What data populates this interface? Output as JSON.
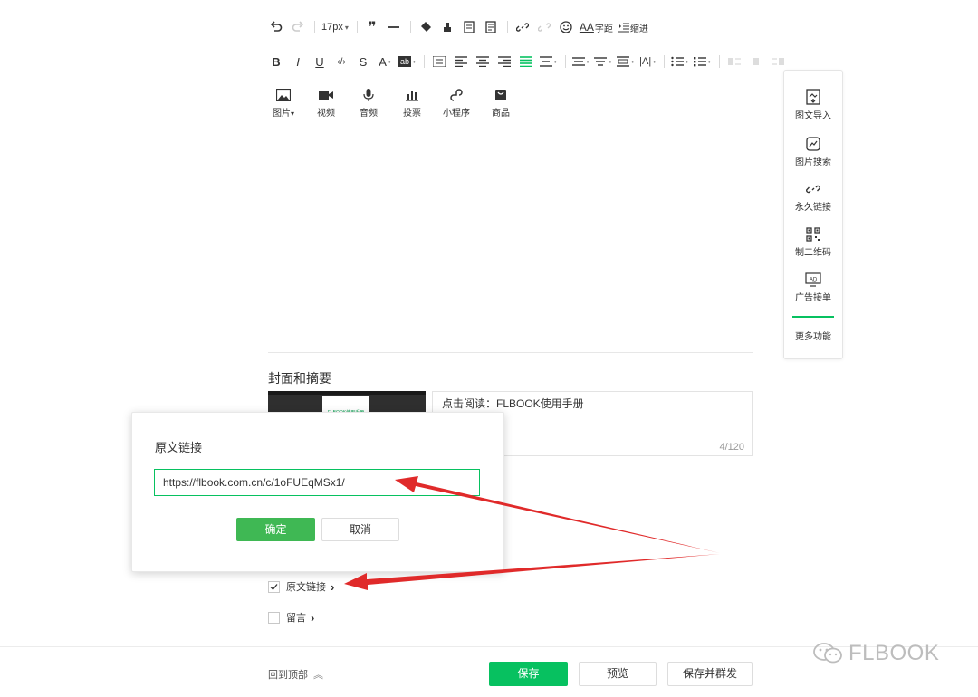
{
  "toolbar": {
    "font_size": "17px",
    "letter_spacing_label": "字距",
    "indent_label": "缩进",
    "text_color_label": "A",
    "highlight_label": "ab"
  },
  "insert_bar": [
    {
      "label": "图片",
      "icon": "image-icon"
    },
    {
      "label": "视频",
      "icon": "video-icon"
    },
    {
      "label": "音频",
      "icon": "audio-icon"
    },
    {
      "label": "投票",
      "icon": "vote-icon"
    },
    {
      "label": "小程序",
      "icon": "mini-program-icon"
    },
    {
      "label": "商品",
      "icon": "product-icon"
    }
  ],
  "side_panel": {
    "items": [
      {
        "label": "图文导入",
        "icon": "import-icon"
      },
      {
        "label": "图片搜索",
        "icon": "image-search-icon"
      },
      {
        "label": "永久链接",
        "icon": "link-icon"
      },
      {
        "label": "制二维码",
        "icon": "qrcode-icon"
      },
      {
        "label": "广告接单",
        "icon": "ad-icon"
      }
    ],
    "more": "更多功能"
  },
  "cover": {
    "section_title": "封面和摘要",
    "thumb_text": "FLBOOK使用手册",
    "summary": "点击阅读：FLBOOK使用手册",
    "counter": "4/120"
  },
  "dialog": {
    "title": "原文链接",
    "url_value": "https://flbook.com.cn/c/1oFUEqMSx1/",
    "confirm": "确定",
    "cancel": "取消"
  },
  "options": {
    "original_link": "原文链接",
    "comments": "留言",
    "chevron": "›"
  },
  "footer": {
    "back_top": "回到顶部",
    "back_top_arrow": "≈",
    "save": "保存",
    "preview": "预览",
    "save_send": "保存并群发"
  },
  "watermark": "FLBOOK",
  "colors": {
    "accent": "#07c160",
    "annotation_arrow": "#e02a2a",
    "border": "#e5e5e5"
  }
}
